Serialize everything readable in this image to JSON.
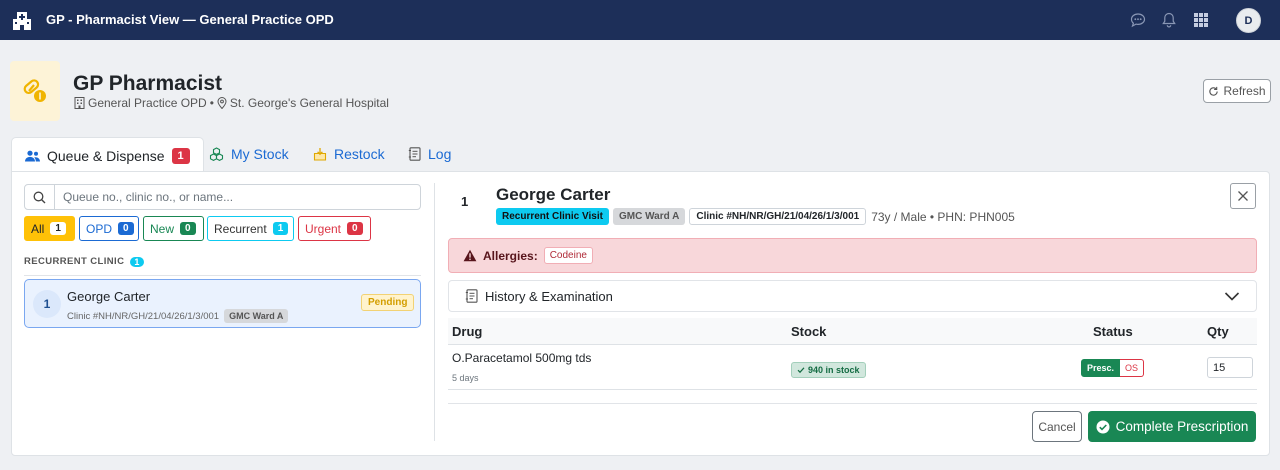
{
  "topbar": {
    "title": "GP - Pharmacist View — General Practice OPD",
    "user_initial": "D",
    "icons": [
      "hospital-icon",
      "chat-icon",
      "bell-icon",
      "grid-icon"
    ]
  },
  "header": {
    "title": "GP Pharmacist",
    "department": "General Practice OPD",
    "separator": "•",
    "hospital": "St. George's General Hospital",
    "refresh_label": "Refresh"
  },
  "tabs": [
    {
      "label": "Queue & Dispense",
      "count": "1",
      "active": true
    },
    {
      "label": "My Stock"
    },
    {
      "label": "Restock"
    },
    {
      "label": "Log"
    }
  ],
  "queue": {
    "search_placeholder": "Queue no., clinic no., or name...",
    "filters": [
      {
        "label": "All",
        "count": "1"
      },
      {
        "label": "OPD",
        "count": "0"
      },
      {
        "label": "New",
        "count": "0"
      },
      {
        "label": "Recurrent",
        "count": "1"
      },
      {
        "label": "Urgent",
        "count": "0"
      }
    ],
    "section": {
      "label": "RECURRENT CLINIC",
      "count": "1"
    },
    "items": [
      {
        "number": "1",
        "name": "George Carter",
        "clinic": "Clinic #NH/NR/GH/21/04/26/1/3/001",
        "ward": "GMC Ward A",
        "status": "Pending"
      }
    ]
  },
  "patient": {
    "queue_number": "1",
    "name": "George Carter",
    "visit_type": "Recurrent Clinic Visit",
    "ward": "GMC Ward A",
    "clinic": "Clinic #NH/NR/GH/21/04/26/1/3/001",
    "meta": "73y / Male • PHN: PHN005",
    "allergies_label": "Allergies:",
    "allergies": [
      "Codeine"
    ],
    "history_label": "History & Examination"
  },
  "prescription": {
    "columns": {
      "drug": "Drug",
      "stock": "Stock",
      "status": "Status",
      "qty": "Qty"
    },
    "rows": [
      {
        "drug": "O.Paracetamol 500mg tds",
        "duration": "5 days",
        "stock": "940 in stock",
        "status_presc": "Presc.",
        "status_os": "OS",
        "qty": "15"
      }
    ]
  },
  "actions": {
    "cancel": "Cancel",
    "complete": "Complete Prescription"
  },
  "colors": {
    "topbar": "#1d2f59",
    "primary": "#1b6ad3",
    "success": "#198754",
    "danger": "#dc3545",
    "info": "#0dcaf0",
    "warning": "#ffc107"
  }
}
